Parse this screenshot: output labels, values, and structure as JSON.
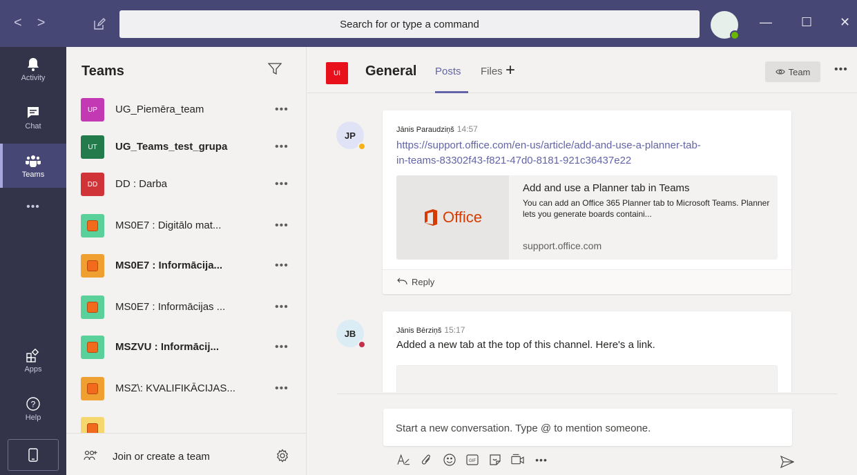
{
  "titlebar": {
    "search_placeholder": "Search for or type a command",
    "back_glyph": "<",
    "forward_glyph": ">",
    "minimize_glyph": "—",
    "maximize_glyph": "☐",
    "close_glyph": "✕"
  },
  "rail": {
    "items": [
      {
        "label": "Activity",
        "icon": "bell-icon"
      },
      {
        "label": "Chat",
        "icon": "chat-icon"
      },
      {
        "label": "Teams",
        "icon": "teams-icon",
        "active": true
      },
      {
        "label": "•••",
        "icon": "more-icon"
      },
      {
        "label": "Apps",
        "icon": "apps-icon"
      },
      {
        "label": "Help",
        "icon": "help-icon"
      }
    ]
  },
  "teams_panel": {
    "title": "Teams",
    "footer_label": "Join or create a team",
    "teams": [
      {
        "abbr": "UP",
        "name": "UG_Piemēra_team",
        "color": "#c239b3",
        "bold": false
      },
      {
        "abbr": "UT",
        "name": "UG_Teams_test_grupa",
        "color": "#237b4b",
        "bold": true
      },
      {
        "abbr": "DD",
        "name": "DD  : Darba",
        "color": "#d13438",
        "bold": false
      },
      {
        "abbr": "",
        "name": "MS0E7 : Digitālo mat...",
        "color": "#5ad09a",
        "bold": false
      },
      {
        "abbr": "",
        "name": "MS0E7 : Informācija...",
        "color": "#f0a030",
        "bold": true
      },
      {
        "abbr": "",
        "name": "MS0E7 : Informācijas ...",
        "color": "#5ad09a",
        "bold": false
      },
      {
        "abbr": "",
        "name": "MSZVU : Informācij...",
        "color": "#5ad09a",
        "bold": true
      },
      {
        "abbr": "",
        "name": "MSZ\\: KVALIFIKĀCIJAS...",
        "color": "#f0a030",
        "bold": false
      },
      {
        "abbr": "",
        "name": "",
        "color": "#f5d76e",
        "bold": false
      }
    ]
  },
  "channel": {
    "tile_abbr": "UI",
    "name": "General",
    "tabs": [
      "Posts",
      "Files"
    ],
    "add_tab": "+",
    "team_button": "Team",
    "more": "•••"
  },
  "messages": [
    {
      "initials": "JP",
      "author": "Jānis Paraudziņš",
      "time": "14:57",
      "link_line1": "https://support.office.com/en-us/article/add-and-use-a-planner-tab-",
      "link_line2": "in-teams-83302f43-f821-47d0-8181-921c36437e22",
      "preview": {
        "brand": "Office",
        "title": "Add and use a Planner tab in Teams",
        "desc": "You can add an Office 365 Planner tab to Microsoft Teams. Planner lets you generate boards containi...",
        "domain": "support.office.com"
      },
      "reply": "Reply",
      "status_color": "#f8b218"
    },
    {
      "initials": "JB",
      "author": "Jānis Bērziņš",
      "time": "15:17",
      "text": "Added a new tab at the top of this channel. Here's a link.",
      "status_color": "#c4314b"
    }
  ],
  "compose": {
    "placeholder": "Start a new conversation. Type @ to mention someone.",
    "more": "•••"
  },
  "colors": {
    "titlebar": "#464775",
    "rail": "#33344a",
    "accent": "#6264a7"
  }
}
